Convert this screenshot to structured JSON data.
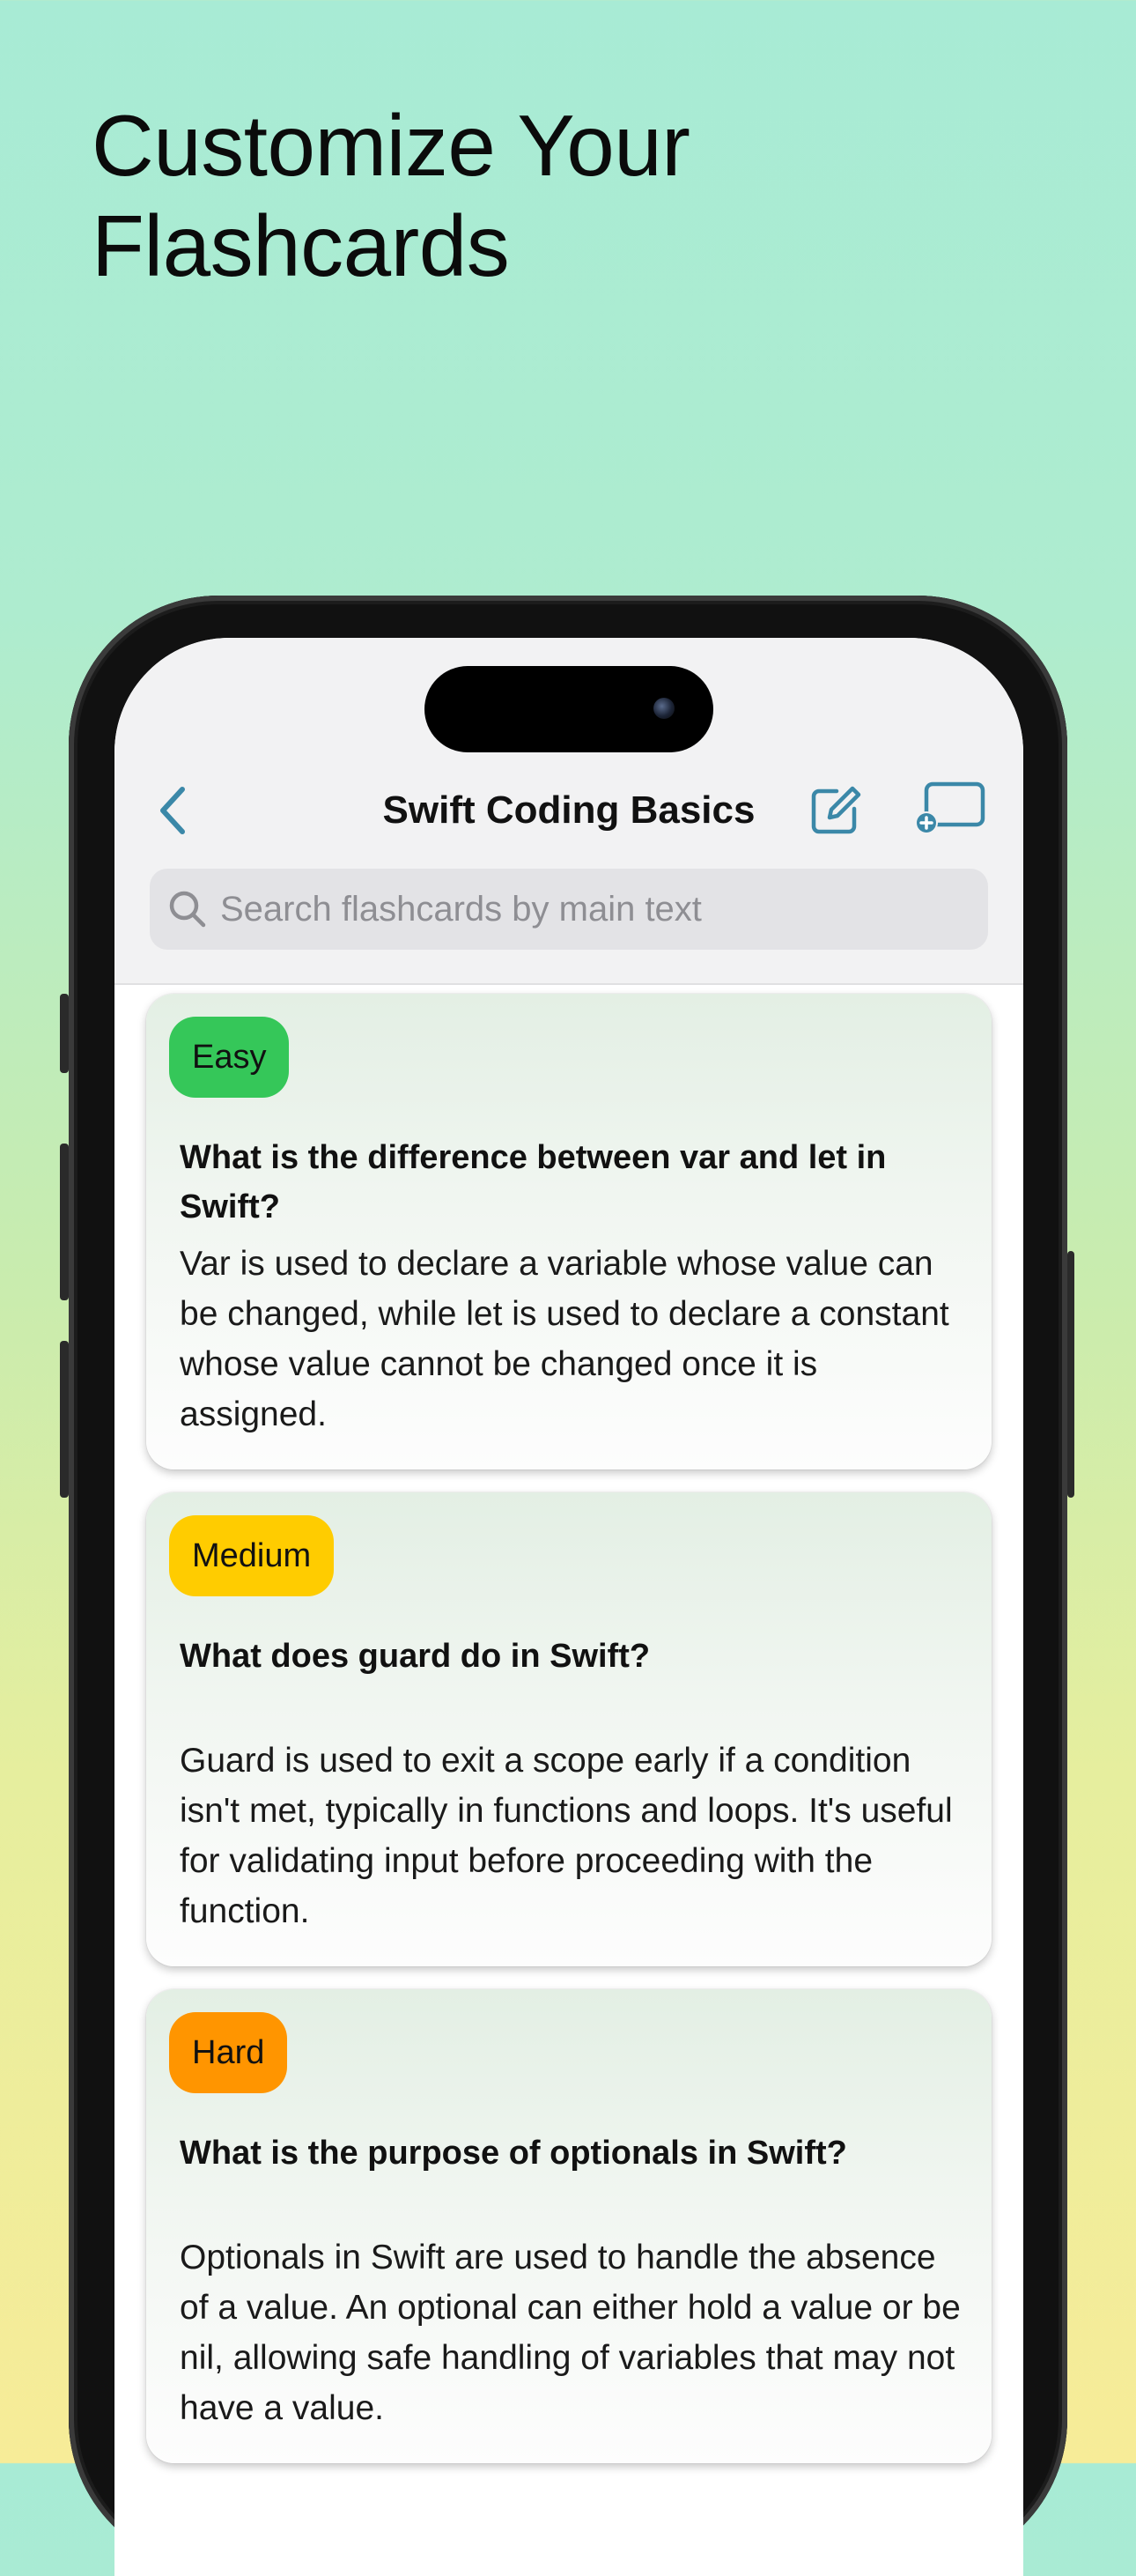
{
  "promo": {
    "headline_line1": "Customize Your",
    "headline_line2": "Flashcards"
  },
  "nav": {
    "title": "Swift Coding Basics",
    "back_icon": "chevron-left-icon",
    "edit_icon": "square-pencil-icon",
    "add_icon": "add-card-icon",
    "accent": "#3b88a8"
  },
  "search": {
    "placeholder": "Search flashcards by main text",
    "value": ""
  },
  "cards": [
    {
      "difficulty": "Easy",
      "badge_color": "#35c759",
      "question": "What is the difference between var and let in Swift?",
      "answer": "Var is used to declare a variable whose value can be changed, while let is used to declare a constant whose value cannot be changed once it is assigned."
    },
    {
      "difficulty": "Medium",
      "badge_color": "#ffcc00",
      "question": "What does guard do in Swift?",
      "answer": "Guard is used to exit a scope early if a condition isn't met, typically in functions and loops. It's useful for validating input before proceeding with the function."
    },
    {
      "difficulty": "Hard",
      "badge_color": "#ff9500",
      "question": "What is the purpose of optionals in Swift?",
      "answer": "Optionals in Swift are used to handle the absence of a value. An optional can either hold a value or be nil, allowing safe handling of variables that may not have a value."
    }
  ]
}
